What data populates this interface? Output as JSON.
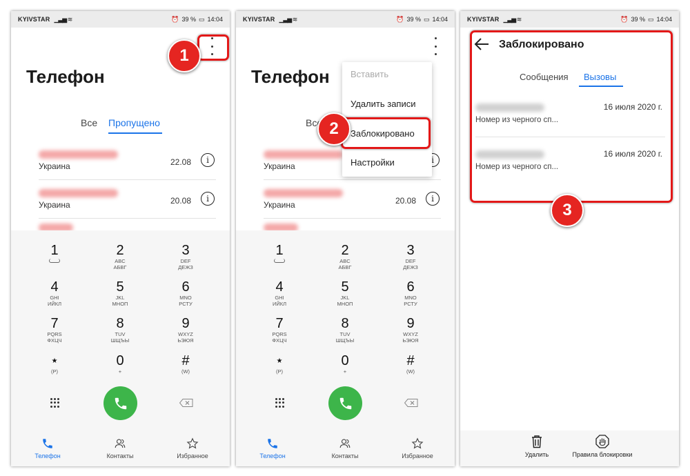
{
  "status_bar": {
    "carrier": "KYIVSTAR",
    "battery": "39 %",
    "time": "14:04"
  },
  "screen1": {
    "title": "Телефон",
    "tabs": [
      "Все",
      "Пропущено"
    ],
    "calls": [
      {
        "location": "Украина",
        "date": "22.08"
      },
      {
        "location": "Украина",
        "date": "20.08"
      }
    ],
    "badge": "1"
  },
  "keypad": [
    {
      "digit": "1",
      "l1": "",
      "l2": ""
    },
    {
      "digit": "2",
      "l1": "ABC",
      "l2": "АБВГ"
    },
    {
      "digit": "3",
      "l1": "DEF",
      "l2": "ДЕЖЗ"
    },
    {
      "digit": "4",
      "l1": "GHI",
      "l2": "ИЙКЛ"
    },
    {
      "digit": "5",
      "l1": "JKL",
      "l2": "МНОП"
    },
    {
      "digit": "6",
      "l1": "MNO",
      "l2": "РСТУ"
    },
    {
      "digit": "7",
      "l1": "PQRS",
      "l2": "ФХЦЧ"
    },
    {
      "digit": "8",
      "l1": "TUV",
      "l2": "ШЩЪЫ"
    },
    {
      "digit": "9",
      "l1": "WXYZ",
      "l2": "ЬЭЮЯ"
    },
    {
      "digit": "⋆",
      "l1": "(P)",
      "l2": ""
    },
    {
      "digit": "0",
      "l1": "+",
      "l2": ""
    },
    {
      "digit": "#",
      "l1": "(W)",
      "l2": ""
    }
  ],
  "bottom_nav": [
    "Телефон",
    "Контакты",
    "Избранное"
  ],
  "screen2": {
    "menu": [
      "Вставить",
      "Удалить записи",
      "Заблокировано",
      "Настройки"
    ],
    "badge": "2"
  },
  "screen3": {
    "title": "Заблокировано",
    "tabs": [
      "Сообщения",
      "Вызовы"
    ],
    "entries": [
      {
        "date": "16 июля 2020 г.",
        "desc": "Номер из черного сп..."
      },
      {
        "date": "16 июля 2020 г.",
        "desc": "Номер из черного сп..."
      }
    ],
    "actions": [
      "Удалить",
      "Правила блокировки"
    ],
    "badge": "3"
  },
  "colors": {
    "accent": "#1a73e8",
    "call_green": "#3db54a",
    "highlight_red": "#e31818"
  }
}
